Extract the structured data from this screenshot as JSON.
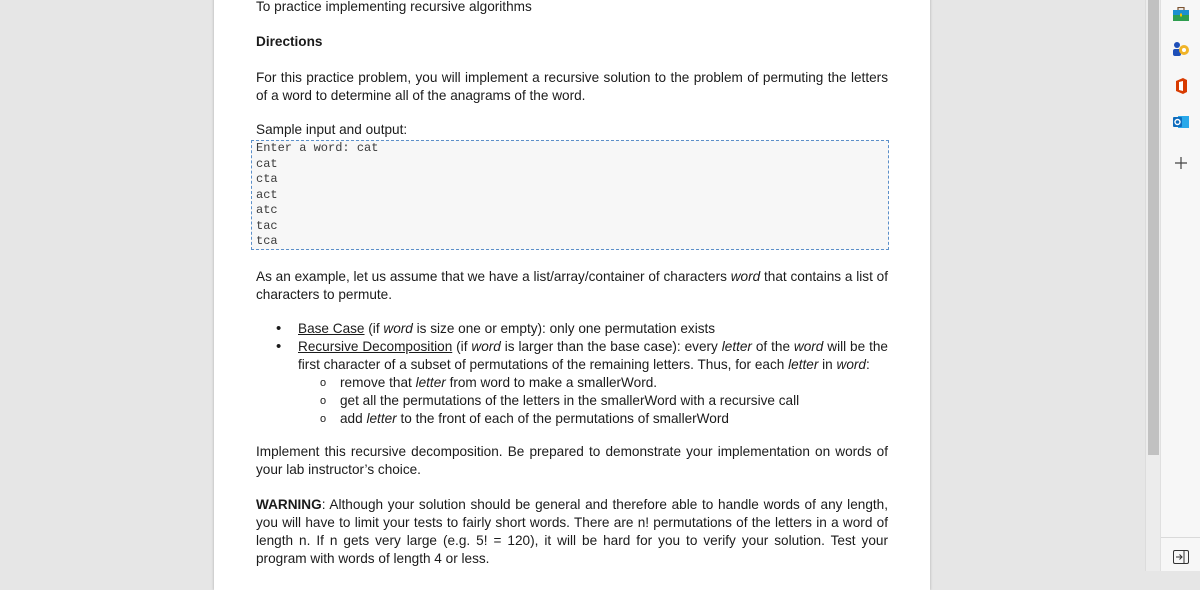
{
  "document": {
    "objective_line": "To practice implementing recursive algorithms",
    "directions_heading": "Directions",
    "intro": "For this practice problem, you will implement a recursive solution to the problem of permuting the letters of a word to determine all of the anagrams of the word.",
    "sample_label": "Sample input and output:",
    "sample_lines": [
      "Enter a word: cat",
      "cat",
      "cta",
      "act",
      "atc",
      "tac",
      "tca"
    ],
    "example_pre": "As an example, let us assume that we have a list/array/container of characters ",
    "example_word": "word",
    "example_post": " that contains a list of characters to permute.",
    "bullets": {
      "base_title": "Base Case",
      "base_a": " (if ",
      "base_word": "word",
      "base_b": " is size one or empty): only one permutation exists",
      "rec_title": "Recursive Decomposition",
      "rec_a": " (if ",
      "rec_word": "word",
      "rec_b": " is larger than the base case): every ",
      "rec_letter": "letter",
      "rec_c": " of the ",
      "rec_word2": "word",
      "rec_d": " will be the first character of a subset of permutations of the remaining letters.  Thus, for each ",
      "rec_letter2": "letter",
      "rec_e": " in ",
      "rec_word3": "word",
      "rec_f": ":",
      "sub1_a": "remove that ",
      "sub1_letter": "letter",
      "sub1_b": " from word to make a smallerWord.",
      "sub2": "get all the permutations of the letters in the smallerWord with a recursive call",
      "sub3_a": "add ",
      "sub3_letter": "letter",
      "sub3_b": " to the front of each of the permutations of smallerWord"
    },
    "implement": "Implement this recursive decomposition.  Be prepared to demonstrate your implementation on words of your lab instructor’s choice.",
    "warning_label": "WARNING",
    "warning_text": ": Although your solution should be general and therefore able to handle words of any length, you will have to limit your tests to fairly short words.  There are n! permutations of the letters in a word of length n.  If n gets very large (e.g. 5! = 120), it will be hard for you to verify your solution.  Test your program with words of length 4 or less."
  },
  "sidebar": {
    "icons": [
      "briefcase-icon",
      "people-icon",
      "office-icon",
      "outlook-icon",
      "add-icon",
      "collapse-sidebar-icon"
    ],
    "colors": {
      "office": "#d83b01",
      "outlook": "#0f6cbd",
      "briefcase": "#1b8fcf"
    }
  }
}
